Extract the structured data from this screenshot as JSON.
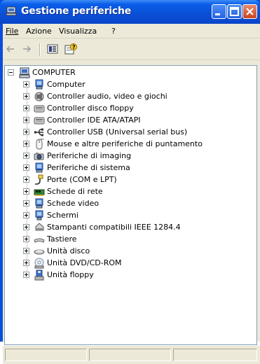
{
  "window": {
    "title": "Gestione periferiche",
    "accent": "#0a4ee0"
  },
  "menu": [
    {
      "label": "File"
    },
    {
      "label": "Azione"
    },
    {
      "label": "Visualizza"
    },
    {
      "label": "?"
    }
  ],
  "toolbar": {
    "back_icon": "back-arrow-icon",
    "forward_icon": "forward-arrow-icon",
    "properties_icon": "properties-icon",
    "help_icon": "help-icon"
  },
  "tree": {
    "root": {
      "label": "COMPUTER",
      "icon": "computer-icon"
    },
    "items": [
      {
        "label": "Computer",
        "icon": "computer-icon"
      },
      {
        "label": "Controller audio, video e giochi",
        "icon": "sound-icon"
      },
      {
        "label": "Controller disco floppy",
        "icon": "floppy-controller-icon"
      },
      {
        "label": "Controller IDE ATA/ATAPI",
        "icon": "ide-controller-icon"
      },
      {
        "label": "Controller USB (Universal serial bus)",
        "icon": "usb-icon"
      },
      {
        "label": "Mouse e altre periferiche di puntamento",
        "icon": "mouse-icon"
      },
      {
        "label": "Periferiche di imaging",
        "icon": "camera-icon"
      },
      {
        "label": "Periferiche di sistema",
        "icon": "system-device-icon"
      },
      {
        "label": "Porte (COM e LPT)",
        "icon": "port-icon"
      },
      {
        "label": "Schede di rete",
        "icon": "network-card-icon"
      },
      {
        "label": "Schede video",
        "icon": "display-adapter-icon"
      },
      {
        "label": "Schermi",
        "icon": "monitor-icon"
      },
      {
        "label": "Stampanti compatibili IEEE 1284.4",
        "icon": "printer-icon"
      },
      {
        "label": "Tastiere",
        "icon": "keyboard-icon"
      },
      {
        "label": "Unità disco",
        "icon": "disk-drive-icon"
      },
      {
        "label": "Unità DVD/CD-ROM",
        "icon": "cdrom-icon"
      },
      {
        "label": "Unità floppy",
        "icon": "floppy-drive-icon"
      }
    ]
  }
}
